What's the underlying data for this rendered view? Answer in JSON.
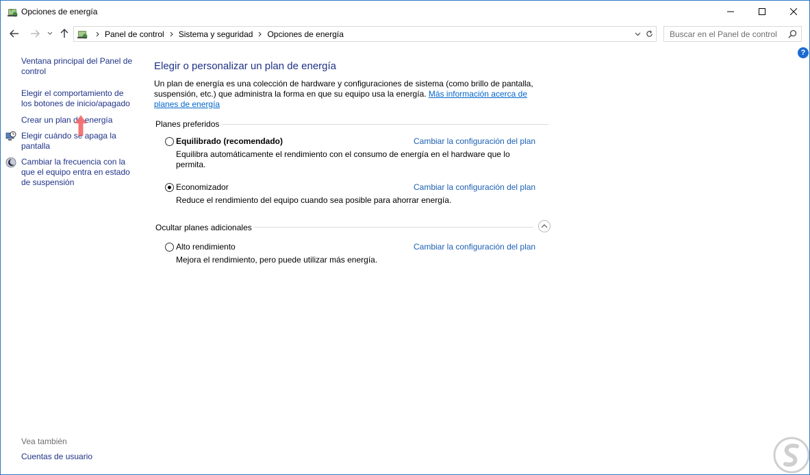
{
  "window": {
    "title": "Opciones de energía"
  },
  "address": {
    "crumbs": [
      "Panel de control",
      "Sistema y seguridad",
      "Opciones de energía"
    ]
  },
  "search": {
    "placeholder": "Buscar en el Panel de control"
  },
  "help": {
    "symbol": "?"
  },
  "sidebar": {
    "home_link": "Ventana principal del Panel de control",
    "tasks": [
      "Elegir el comportamiento de los botones de inicio/apagado",
      "Crear un plan de energía",
      "Elegir cuándo se apaga la pantalla",
      "Cambiar la frecuencia con la que el equipo entra en estado de suspensión"
    ],
    "see_also_label": "Vea también",
    "see_also_links": [
      "Cuentas de usuario"
    ]
  },
  "main": {
    "title": "Elegir o personalizar un plan de energía",
    "intro_text": "Un plan de energía es una colección de hardware y configuraciones de sistema (como brillo de pantalla, suspensión, etc.) que administra la forma en que su equipo usa la energía.",
    "intro_link": "Más información acerca de planes de energía",
    "preferred_header": "Planes preferidos",
    "preferred_plans": [
      {
        "name": "Equilibrado (recomendado)",
        "change_label": "Cambiar la configuración del plan",
        "description": "Equilibra automáticamente el rendimiento con el consumo de energía en el hardware que lo permita.",
        "selected": false
      },
      {
        "name": "Economizador",
        "change_label": "Cambiar la configuración del plan",
        "description": "Reduce el rendimiento del equipo cuando sea posible para ahorrar energía.",
        "selected": true
      }
    ],
    "additional_header": "Ocultar planes adicionales",
    "additional_plans": [
      {
        "name": "Alto rendimiento",
        "change_label": "Cambiar la configuración del plan",
        "description": "Mejora el rendimiento, pero puede utilizar más energía.",
        "selected": false
      }
    ]
  },
  "colors": {
    "link": "#1e3287",
    "accent_link": "#1b5fb4",
    "window_border": "#2b78c5",
    "arrow": "#f36b6b"
  }
}
